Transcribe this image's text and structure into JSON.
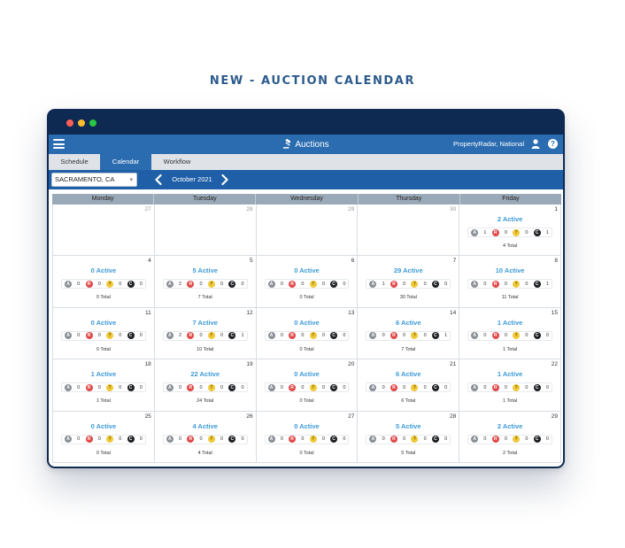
{
  "headline": "NEW - AUCTION CALENDAR",
  "window_dots": [
    "#ff5f57",
    "#febc2e",
    "#28c840"
  ],
  "app": {
    "title": "Auctions",
    "account": "PropertyRadar, National",
    "help": "?"
  },
  "tabs": [
    "Schedule",
    "Calendar",
    "Workflow"
  ],
  "active_tab": "Calendar",
  "controls": {
    "city": "SACRAMENTO, CA",
    "month": "October 2021"
  },
  "weekdays": [
    "Monday",
    "Tuesday",
    "Wednesday",
    "Thursday",
    "Friday"
  ],
  "badge_letters": [
    "A",
    "R",
    "?",
    "C"
  ],
  "weeks": [
    [
      {
        "day": "27",
        "in_month": false
      },
      {
        "day": "28",
        "in_month": false
      },
      {
        "day": "29",
        "in_month": false
      },
      {
        "day": "30",
        "in_month": false
      },
      {
        "day": "1",
        "in_month": true,
        "active": "2 Active",
        "counts": [
          "1",
          "0",
          "0",
          "1"
        ],
        "total": "4 Total"
      }
    ],
    [
      {
        "day": "4",
        "in_month": true,
        "active": "0 Active",
        "counts": [
          "0",
          "0",
          "0",
          "0"
        ],
        "total": "0 Total"
      },
      {
        "day": "5",
        "in_month": true,
        "active": "5 Active",
        "counts": [
          "2",
          "0",
          "0",
          "0"
        ],
        "total": "7 Total"
      },
      {
        "day": "6",
        "in_month": true,
        "active": "0 Active",
        "counts": [
          "0",
          "0",
          "0",
          "0"
        ],
        "total": "0 Total"
      },
      {
        "day": "7",
        "in_month": true,
        "active": "29 Active",
        "counts": [
          "1",
          "0",
          "0",
          "0"
        ],
        "total": "30 Total"
      },
      {
        "day": "8",
        "in_month": true,
        "active": "10 Active",
        "counts": [
          "0",
          "0",
          "0",
          "1"
        ],
        "total": "11 Total"
      }
    ],
    [
      {
        "day": "11",
        "in_month": true,
        "active": "0 Active",
        "counts": [
          "0",
          "0",
          "0",
          "0"
        ],
        "total": "0 Total"
      },
      {
        "day": "12",
        "in_month": true,
        "active": "7 Active",
        "counts": [
          "2",
          "0",
          "0",
          "1"
        ],
        "total": "10 Total"
      },
      {
        "day": "13",
        "in_month": true,
        "active": "0 Active",
        "counts": [
          "0",
          "0",
          "0",
          "0"
        ],
        "total": "0 Total"
      },
      {
        "day": "14",
        "in_month": true,
        "active": "6 Active",
        "counts": [
          "0",
          "0",
          "0",
          "1"
        ],
        "total": "7 Total"
      },
      {
        "day": "15",
        "in_month": true,
        "active": "1 Active",
        "counts": [
          "0",
          "0",
          "0",
          "0"
        ],
        "total": "1 Total"
      }
    ],
    [
      {
        "day": "18",
        "in_month": true,
        "active": "1 Active",
        "counts": [
          "0",
          "0",
          "0",
          "0"
        ],
        "total": "1 Total"
      },
      {
        "day": "19",
        "in_month": true,
        "active": "22 Active",
        "counts": [
          "0",
          "0",
          "0",
          "0"
        ],
        "total": "24 Total"
      },
      {
        "day": "20",
        "in_month": true,
        "active": "0 Active",
        "counts": [
          "0",
          "0",
          "0",
          "0"
        ],
        "total": "0 Total"
      },
      {
        "day": "21",
        "in_month": true,
        "active": "6 Active",
        "counts": [
          "0",
          "0",
          "0",
          "0"
        ],
        "total": "6 Total"
      },
      {
        "day": "22",
        "in_month": true,
        "active": "1 Active",
        "counts": [
          "0",
          "0",
          "0",
          "0"
        ],
        "total": "1 Total"
      }
    ],
    [
      {
        "day": "25",
        "in_month": true,
        "active": "0 Active",
        "counts": [
          "0",
          "0",
          "0",
          "0"
        ],
        "total": "0 Total"
      },
      {
        "day": "26",
        "in_month": true,
        "active": "4 Active",
        "counts": [
          "0",
          "0",
          "0",
          "0"
        ],
        "total": "4 Total"
      },
      {
        "day": "27",
        "in_month": true,
        "active": "0 Active",
        "counts": [
          "0",
          "0",
          "0",
          "0"
        ],
        "total": "0 Total"
      },
      {
        "day": "28",
        "in_month": true,
        "active": "5 Active",
        "counts": [
          "0",
          "0",
          "0",
          "0"
        ],
        "total": "5 Total"
      },
      {
        "day": "29",
        "in_month": true,
        "active": "2 Active",
        "counts": [
          "0",
          "0",
          "0",
          "0"
        ],
        "total": "2 Total"
      }
    ]
  ]
}
